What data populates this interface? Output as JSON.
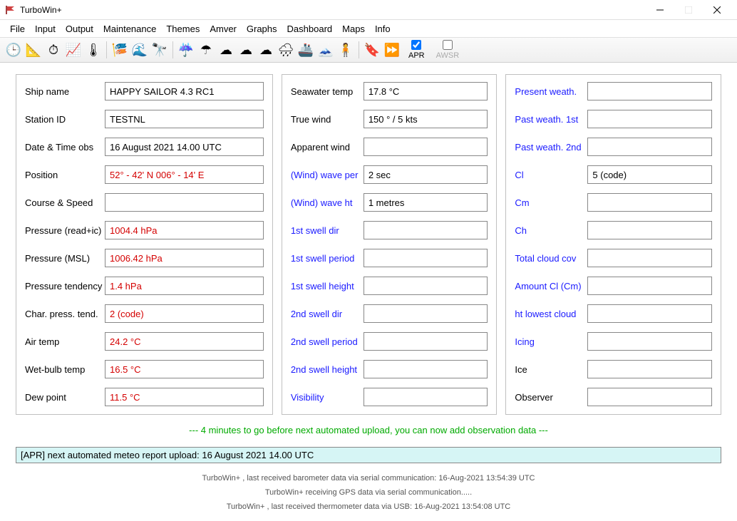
{
  "window": {
    "title": "TurboWin+"
  },
  "menu": [
    "File",
    "Input",
    "Output",
    "Maintenance",
    "Themes",
    "Amver",
    "Graphs",
    "Dashboard",
    "Maps",
    "Info"
  ],
  "toolbar_icons": [
    {
      "name": "clock-icon",
      "glyph": "🕒"
    },
    {
      "name": "compass-icon",
      "glyph": "📐"
    },
    {
      "name": "gauge-icon",
      "glyph": "⏱"
    },
    {
      "name": "chart-icon",
      "glyph": "📈"
    },
    {
      "name": "thermometer-icon",
      "glyph": "🌡"
    },
    {
      "name": "__sep"
    },
    {
      "name": "windsock-icon",
      "glyph": "🎏"
    },
    {
      "name": "wave-icon",
      "glyph": "🌊"
    },
    {
      "name": "binoculars-icon",
      "glyph": "🔭"
    },
    {
      "name": "__sep"
    },
    {
      "name": "rain-purple-icon",
      "glyph": "☔"
    },
    {
      "name": "umbrella-icon",
      "glyph": "☂"
    },
    {
      "name": "cloud-cl-icon",
      "glyph": "☁"
    },
    {
      "name": "cloud-cm-icon",
      "glyph": "☁"
    },
    {
      "name": "cloud-ch-icon",
      "glyph": "☁"
    },
    {
      "name": "cloud-total-icon",
      "glyph": "🌧"
    },
    {
      "name": "ship-icon",
      "glyph": "🚢"
    },
    {
      "name": "iceberg-icon",
      "glyph": "🗻"
    },
    {
      "name": "person-icon",
      "glyph": "🧍"
    },
    {
      "name": "__sep"
    },
    {
      "name": "bookmark-icon",
      "glyph": "🔖"
    },
    {
      "name": "forward-icon",
      "glyph": "⏩"
    }
  ],
  "toolbar_check": {
    "apr": {
      "label": "APR",
      "checked": true
    },
    "awsr": {
      "label": "AWSR",
      "checked": false
    }
  },
  "col1": [
    {
      "label": "Ship name",
      "value": "HAPPY SAILOR 4.3 RC1",
      "cls": ""
    },
    {
      "label": "Station ID",
      "value": "TESTNL",
      "cls": ""
    },
    {
      "label": "Date & Time obs",
      "value": "16 August 2021  14.00 UTC",
      "cls": ""
    },
    {
      "label": "Position",
      "value": "52° - 42' N  006° - 14' E",
      "cls": "red"
    },
    {
      "label": "Course & Speed",
      "value": "",
      "cls": ""
    },
    {
      "label": "Pressure (read+ic)",
      "value": "1004.4 hPa",
      "cls": "red"
    },
    {
      "label": "Pressure (MSL)",
      "value": "1006.42 hPa",
      "cls": "red"
    },
    {
      "label": "Pressure tendency",
      "value": "1.4 hPa",
      "cls": "red"
    },
    {
      "label": "Char. press. tend.",
      "value": "2 (code)",
      "cls": "red"
    },
    {
      "label": "Air temp",
      "value": "24.2 °C",
      "cls": "red"
    },
    {
      "label": "Wet-bulb temp",
      "value": "16.5 °C",
      "cls": "red"
    },
    {
      "label": "Dew point",
      "value": "11.5 °C",
      "cls": "red"
    }
  ],
  "col2": [
    {
      "label": "Seawater temp",
      "value": "17.8 °C",
      "blue": false
    },
    {
      "label": "True wind",
      "value": "150 ° / 5 kts",
      "blue": false
    },
    {
      "label": "Apparent wind",
      "value": "",
      "blue": false
    },
    {
      "label": "(Wind) wave per",
      "value": "2 sec",
      "blue": true
    },
    {
      "label": "(Wind) wave ht",
      "value": "1 metres",
      "blue": true
    },
    {
      "label": "1st swell dir",
      "value": "",
      "blue": true
    },
    {
      "label": "1st swell period",
      "value": "",
      "blue": true
    },
    {
      "label": "1st swell height",
      "value": "",
      "blue": true
    },
    {
      "label": "2nd swell dir",
      "value": "",
      "blue": true
    },
    {
      "label": "2nd swell period",
      "value": "",
      "blue": true
    },
    {
      "label": "2nd swell height",
      "value": "",
      "blue": true
    },
    {
      "label": "Visibility",
      "value": "",
      "blue": true
    }
  ],
  "col3": [
    {
      "label": "Present weath.",
      "value": "",
      "blue": true
    },
    {
      "label": "Past weath. 1st",
      "value": "",
      "blue": true
    },
    {
      "label": "Past weath. 2nd",
      "value": "",
      "blue": true
    },
    {
      "label": "Cl",
      "value": "5 (code)",
      "blue": true
    },
    {
      "label": "Cm",
      "value": "",
      "blue": true
    },
    {
      "label": "Ch",
      "value": "",
      "blue": true
    },
    {
      "label": "Total cloud cov",
      "value": "",
      "blue": true
    },
    {
      "label": "Amount Cl (Cm)",
      "value": "",
      "blue": true
    },
    {
      "label": "ht lowest cloud",
      "value": "",
      "blue": true
    },
    {
      "label": "Icing",
      "value": "",
      "blue": true
    },
    {
      "label": "Ice",
      "value": "",
      "blue": false
    },
    {
      "label": "Observer",
      "value": "",
      "blue": false
    }
  ],
  "notice": "--- 4 minutes to go before next automated upload, you can now add observation data ---",
  "report": "[APR] next automated meteo report upload: 16 August 2021 14.00 UTC",
  "footer": [
    "TurboWin+ , last received barometer data via serial communication: 16-Aug-2021 13:54:39 UTC",
    "TurboWin+ receiving GPS data via serial communication.....",
    "TurboWin+ , last received thermometer data via USB: 16-Aug-2021 13:54:08 UTC"
  ]
}
